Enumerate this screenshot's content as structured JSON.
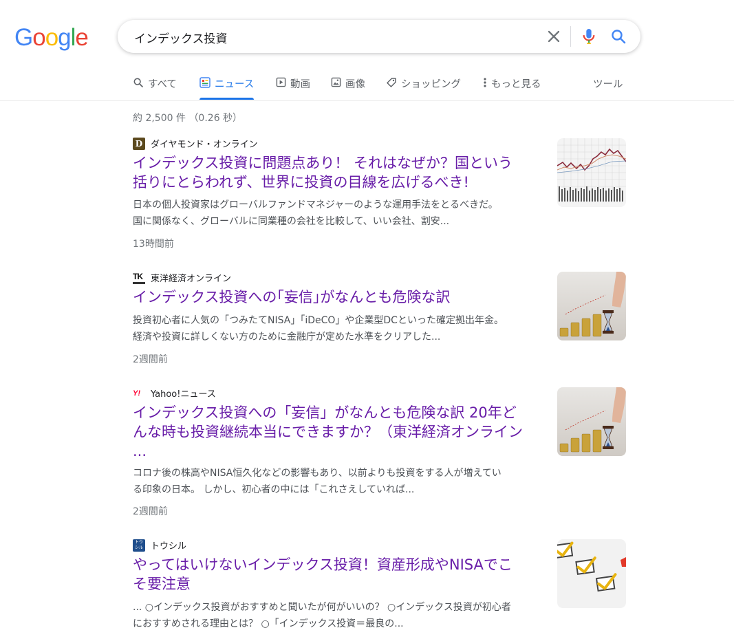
{
  "brand": {
    "logo_letters": [
      "G",
      "o",
      "o",
      "g",
      "l",
      "e"
    ],
    "logo_colors": [
      "#4285F4",
      "#EA4335",
      "#FBBC05",
      "#4285F4",
      "#34A853",
      "#EA4335"
    ]
  },
  "search": {
    "query": "インデックス投資"
  },
  "tabs": [
    {
      "label": "すべて",
      "icon": "search-icon"
    },
    {
      "label": "ニュース",
      "icon": "news-icon",
      "active": true
    },
    {
      "label": "動画",
      "icon": "video-icon"
    },
    {
      "label": "画像",
      "icon": "image-icon"
    },
    {
      "label": "ショッピング",
      "icon": "tag-icon"
    },
    {
      "label": "もっと見る",
      "icon": "more-vert-icon"
    },
    {
      "label": "ツール"
    }
  ],
  "stats": "約 2,500 件 （0.26 秒）",
  "results": [
    {
      "source": "ダイヤモンド・オンライン",
      "favicon_letter": "D",
      "title_lines": [
        "インデックス投資に問題点あり！ それはなぜか？国という",
        "括りにとらわれず、世界に投資の目線を広げるべき!"
      ],
      "snippet_lines": [
        "日本の個人投資家はグローバルファンドマネジャーのような運用手法をとるべきだ。",
        "国に関係なく、グローバルに同業種の会社を比較して、いい会社、割安..."
      ],
      "age": "13時間前",
      "thumb": "stock-chart-thumbnail"
    },
    {
      "source": "東洋経済オンライン",
      "favicon_letter": "TK",
      "title_lines": [
        "インデックス投資への｢妄信｣がなんとも危険な訳"
      ],
      "snippet_lines": [
        "投資初心者に人気の「つみたてNISA」「iDeCO」や企業型DCといった確定拠出年金。",
        "経済や投資に詳しくない方のために金融庁が定めた水準をクリアした..."
      ],
      "age": "2週間前",
      "thumb": "coins-hourglass-thumbnail"
    },
    {
      "source": "Yahoo!ニュース",
      "favicon_letter": "Y!",
      "title_lines": [
        "インデックス投資への「妄信」がなんとも危険な訳 20年ど",
        "んな時も投資継続本当にできますか？（東洋経済オンライン",
        "..."
      ],
      "snippet_lines": [
        "コロナ後の株高やNISA恒久化などの影響もあり、以前よりも投資をする人が増えてい",
        "る印象の日本。 しかし、初心者の中には「これさえしていれば..."
      ],
      "age": "2週間前",
      "thumb": "coins-hourglass-thumbnail"
    },
    {
      "source": "トウシル",
      "favicon_letter": "トウ\nシル",
      "title_lines": [
        "やってはいけないインデックス投資！資産形成やNISAでこ",
        "そ要注意"
      ],
      "snippet_lines": [
        "... ○インデックス投資がおすすめと聞いたが何がいいの？ ○インデックス投資が初心者",
        "におすすめされる理由とは？ ○「インデックス投資＝最良の..."
      ],
      "age": "",
      "thumb": "checklist-thumbnail"
    }
  ]
}
